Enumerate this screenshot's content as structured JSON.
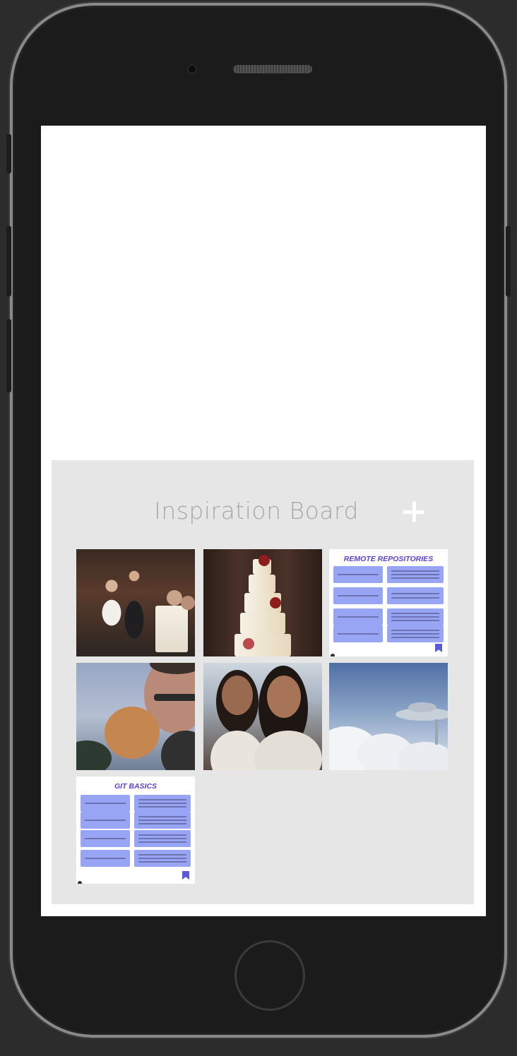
{
  "board": {
    "title": "Inspiration Board",
    "add_label": "+"
  },
  "tiles": [
    {
      "kind": "photo",
      "subject": "wedding-cake-cutting"
    },
    {
      "kind": "photo",
      "subject": "tiered-wedding-cake"
    },
    {
      "kind": "document",
      "title": "REMOTE REPOSITORIES"
    },
    {
      "kind": "photo",
      "subject": "man-with-cat"
    },
    {
      "kind": "photo",
      "subject": "two-friends-selfie"
    },
    {
      "kind": "photo",
      "subject": "cloud-city"
    },
    {
      "kind": "document",
      "title": "GIT BASICS"
    }
  ],
  "colors": {
    "background": "#2c2c2c",
    "board_bg": "#e6e6e6",
    "doc_title": "#5b3fd6",
    "doc_cell": "#98a5f4"
  }
}
